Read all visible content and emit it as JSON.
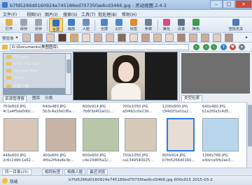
{
  "window": {
    "title": "b7fd5266d0160924e745186ed70735fae6cd3466.jpg - 灵动视图 2.4.3"
  },
  "menu": [
    "文件(F)",
    "视图(V)",
    "图片(I)",
    "搜索(S)",
    "工具(T)",
    "批处理(B)",
    "帮助(H)"
  ],
  "toolbar": {
    "buttons": [
      {
        "label": "打开",
        "icon": "folder-open-icon",
        "color": "#e2b24a"
      },
      {
        "label": "保存",
        "icon": "save-icon",
        "color": "#9aa5b3"
      },
      {
        "label": "另存",
        "icon": "save-as-icon",
        "color": "#9aa5b3"
      },
      {
        "label": "全屏",
        "icon": "fullscreen-icon",
        "color": "#2f6fc0"
      },
      {
        "label": "缩放",
        "icon": "zoom-icon",
        "color": "#3b7fc9"
      },
      {
        "label": "人脸",
        "icon": "face-icon",
        "color": "#6b8fbf"
      },
      {
        "label": "全屏",
        "icon": "monitor-icon",
        "color": "#4a86c9"
      },
      {
        "label": "幻灯",
        "icon": "slideshow-icon",
        "color": "#4a86c9"
      },
      {
        "label": "标签",
        "icon": "tag-icon",
        "color": "#e28a2b"
      },
      {
        "label": "参数",
        "icon": "settings-icon",
        "color": "#6f7f94"
      },
      {
        "label": "美化",
        "icon": "beautify-icon",
        "color": "#d64f7a"
      },
      {
        "label": "设置",
        "icon": "gear-icon",
        "color": "#5f7089"
      },
      {
        "label": "换色",
        "icon": "color-icon",
        "color": "#3f9c4e"
      },
      {
        "label": "查找无关",
        "icon": "search-icon",
        "color": "#4e79b3"
      }
    ]
  },
  "preview": {
    "label": "预览条",
    "thumb_colors": [
      "#d9c3b0",
      "#b98f7a",
      "#e2c7b5",
      "#5a3c2a",
      "#caa895",
      "#f0d8c8",
      "#cfb29d",
      "#dbc4b1",
      "#8b6a58",
      "#eadbcf",
      "#c4a08c",
      "#d7bda9",
      "#e8d6c9",
      "#a98773",
      "#d3b7a4",
      "#c9ad99",
      "#e3cfc1",
      "#b59480"
    ]
  },
  "address": {
    "path": "D:\\Documents\\美图图库\\"
  },
  "tree": {
    "items": [
      "Pictures",
      "RTXC File List",
      "Tencent Files",
      "Temp",
      "迅雷下载"
    ]
  },
  "left_tabs": [
    "资源管理器",
    "图库",
    "分类"
  ],
  "right_tab": "类型检索",
  "grid": {
    "top_captions": [
      "750x600 JPG",
      "640x480 JPG",
      "600x914 JPG",
      "700x1050 JPG",
      "1200x900 JPG",
      "640x480 JPG"
    ],
    "top_captions2": [
      "4c1a4f5de0d0c...",
      "5b3c4a20e1f8a...",
      "7b6f3d4f2a01c...",
      "a5f4b1c0e23d...",
      "c94d2f1e01a2...",
      "b1e2f0a3c4d5..."
    ],
    "captions": [
      "448x600 JPG",
      "400x600 JPG",
      "600x600 JPG",
      "750x1050 JPG",
      "600x914 JPG",
      "1366x768 JPG"
    ],
    "captions2": [
      "2c6c2d9fc1a62...",
      "4f0a2f6da8e3b...",
      "c4e10d6f5a1c...",
      "ca1349540025...",
      "b7fd5266d0160...",
      "e9dcca5fb2ae3..."
    ]
  },
  "bottom_tabs": [
    "同一目录(25)",
    "相同标签",
    "相像人脸",
    "最近浏览"
  ],
  "status": {
    "ready": "就绪",
    "info": "b7fd5266d0160924e745186ed70735fae6cd3466.jpg 600x915  2015-03-2"
  },
  "colors": {
    "accent": "#2b7de1",
    "toolbar_active": "#f8d57a",
    "close": "#c94b3a"
  }
}
